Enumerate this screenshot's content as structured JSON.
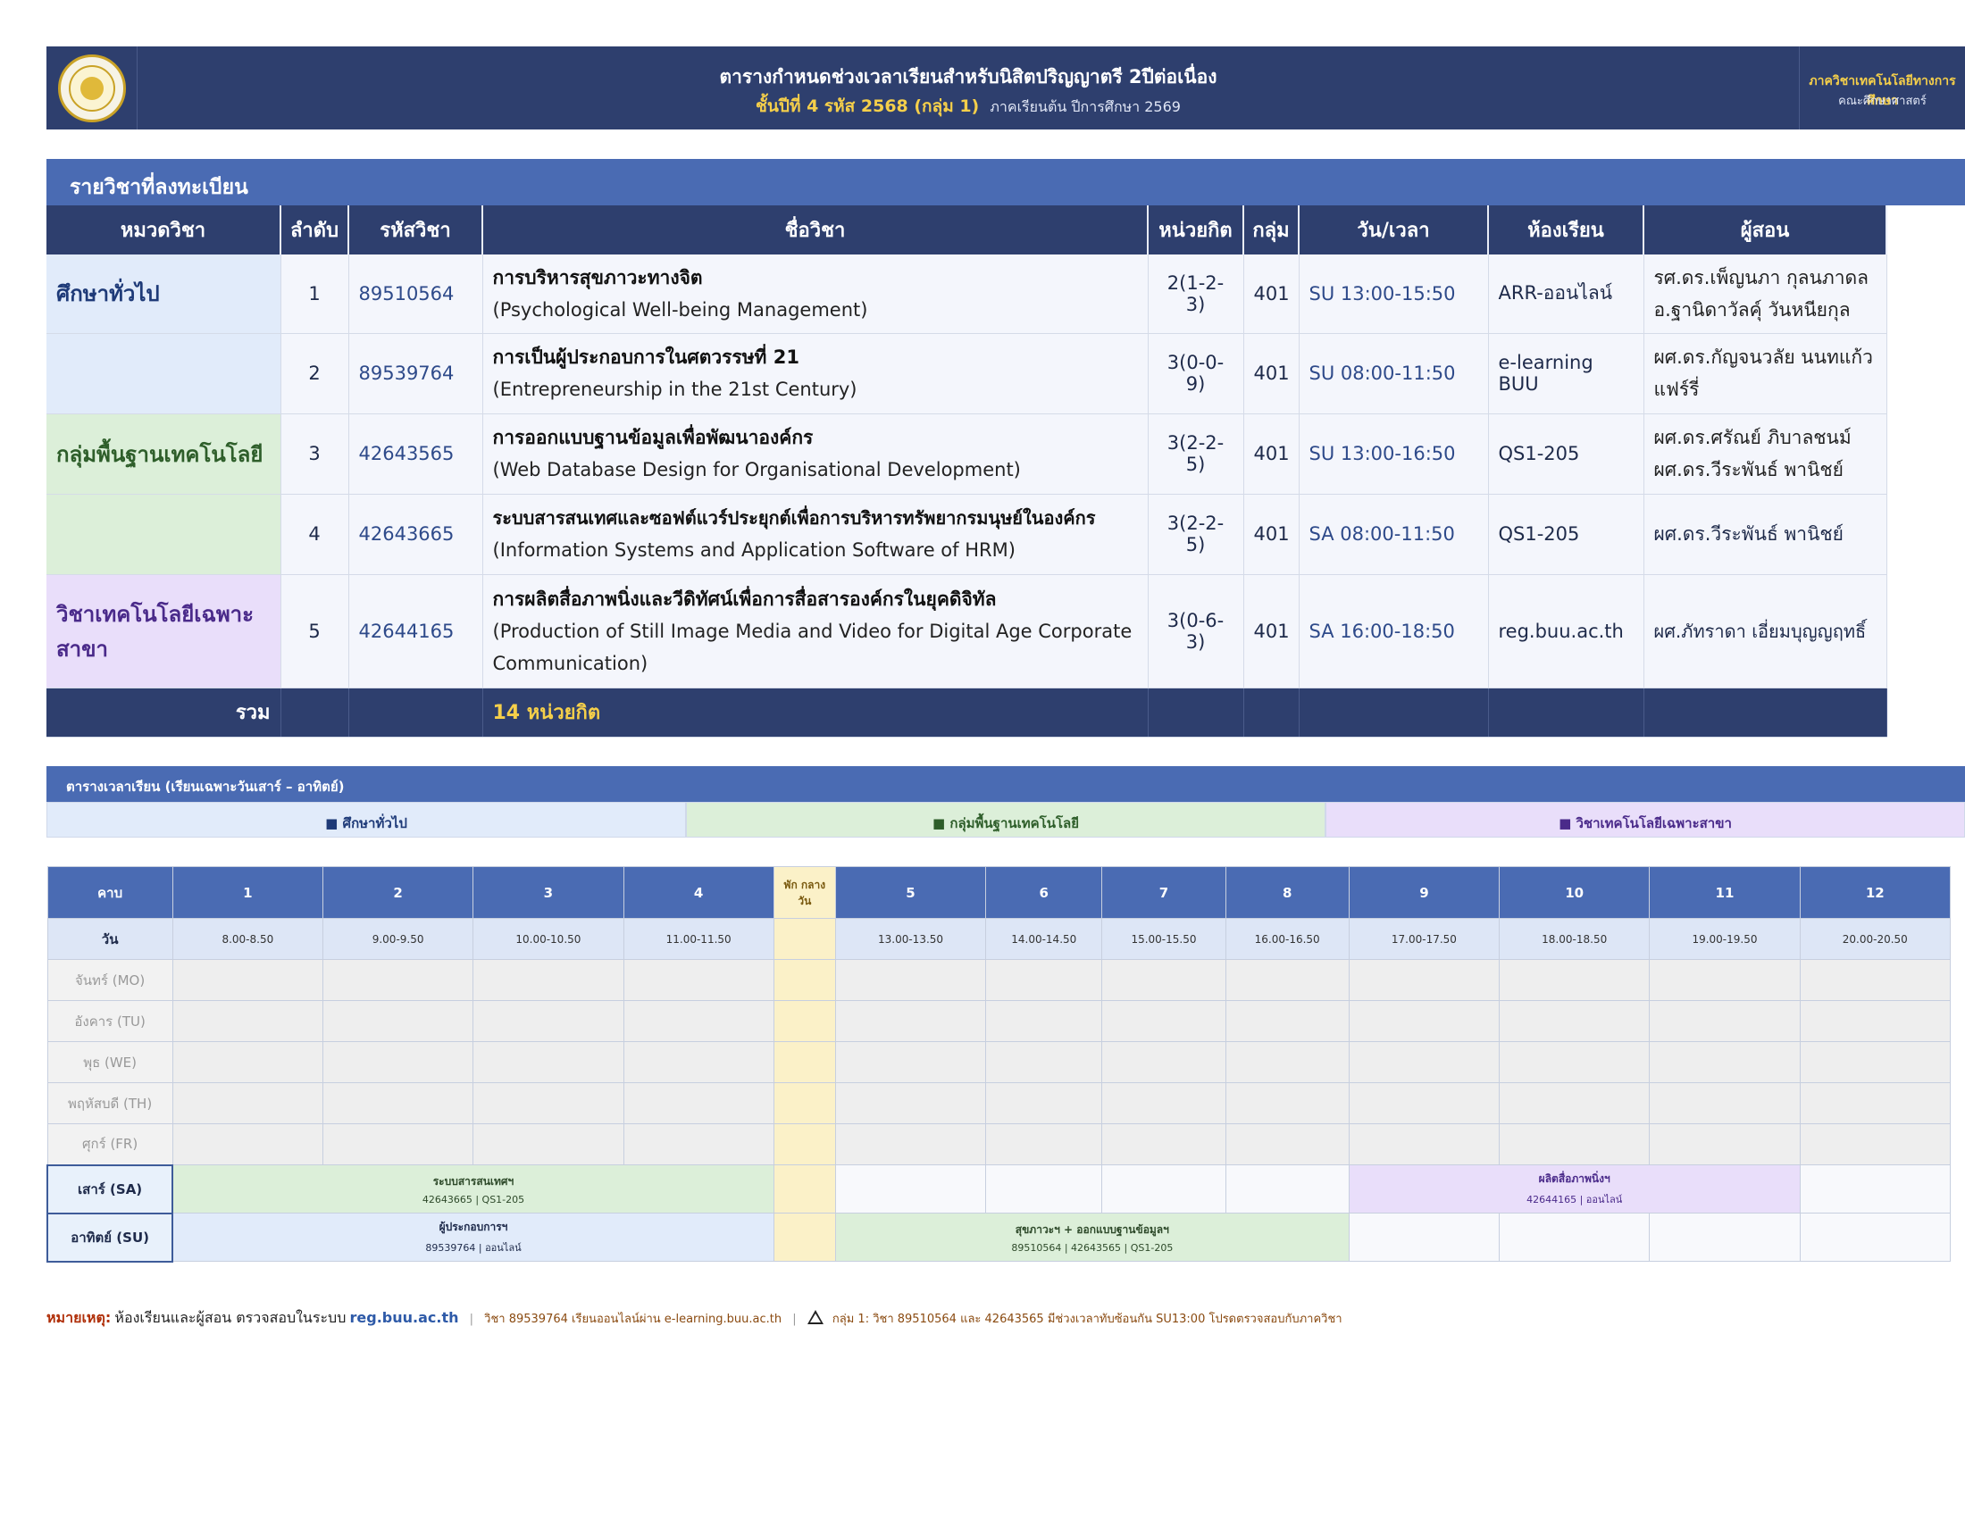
{
  "header": {
    "title": "ตารางกำหนดช่วงเวลาเรียนสำหรับนิสิตปริญญาตรี  2ปีต่อเนื่อง",
    "subtitle_highlight": "ชั้นปีที่ 4  รหัส 2568  (กลุ่ม 1)",
    "subtitle_rest": "ภาคเรียนต้น ปีการศึกษา 2569",
    "dept": "ภาควิชาเทคโนโลยีทางการศึกษา",
    "faculty": "คณะศึกษาศาสตร์"
  },
  "registered": {
    "section_title": "รายวิชาที่ลงทะเบียน",
    "columns": [
      "หมวดวิชา",
      "ลำดับ",
      "รหัสวิชา",
      "ชื่อวิชา",
      "หน่วยกิต",
      "กลุ่ม",
      "วัน/เวลา",
      "ห้องเรียน",
      "ผู้สอน"
    ],
    "categories": [
      "ศึกษาทั่วไป",
      "กลุ่มพื้นฐานเทคโนโลยี",
      "วิชาเทคโนโลยีเฉพาะสาขา"
    ],
    "rows": [
      {
        "no": "1",
        "code": "89510564",
        "name_th": "การบริหารสุขภาวะทางจิต",
        "name_en": "(Psychological Well-being Management)",
        "credit": "2(1-2-3)",
        "group": "401",
        "time": "SU 13:00-15:50",
        "room": "ARR-ออนไลน์",
        "instructor1": "รศ.ดร.เพ็ญนภา กุลนภาดล",
        "instructor2": "อ.ฐานิดาวัลคุ์ วันหนียกุล"
      },
      {
        "no": "2",
        "code": "89539764",
        "name_th": "การเป็นผู้ประกอบการในศตวรรษที่ 21",
        "name_en": "(Entrepreneurship in the 21st Century)",
        "credit": "3(0-0-9)",
        "group": "401",
        "time": "SU 08:00-11:50",
        "room": "e-learning BUU",
        "instructor1": "ผศ.ดร.กัญจนวลัย นนทแก้ว",
        "instructor2": "แฟร์รี่"
      },
      {
        "no": "3",
        "code": "42643565",
        "name_th": "การออกแบบฐานข้อมูลเพื่อพัฒนาองค์กร",
        "name_en": "(Web Database Design for Organisational Development)",
        "credit": "3(2-2-5)",
        "group": "401",
        "time": "SU 13:00-16:50",
        "room": "QS1-205",
        "instructor1": "ผศ.ดร.ศรัณย์ ภิบาลชนม์",
        "instructor2": "ผศ.ดร.วีระพันธ์ พานิชย์"
      },
      {
        "no": "4",
        "code": "42643665",
        "name_th": "ระบบสารสนเทศและซอฟต์แวร์ประยุกต์เพื่อการบริหารทรัพยากรมนุษย์ในองค์กร",
        "name_en": "(Information Systems and Application Software of HRM)",
        "credit": "3(2-2-5)",
        "group": "401",
        "time": "SA 08:00-11:50",
        "room": "QS1-205",
        "instructor1": "ผศ.ดร.วีระพันธ์ พานิชย์",
        "instructor2": ""
      },
      {
        "no": "5",
        "code": "42644165",
        "name_th": "การผลิตสื่อภาพนิ่งและวีดิทัศน์เพื่อการสื่อสารองค์กรในยุคดิจิทัล",
        "name_en": "(Production of Still Image Media and Video for Digital Age Corporate Communication)",
        "credit": "3(0-6-3)",
        "group": "401",
        "time": "SA 16:00-18:50",
        "room": "reg.buu.ac.th",
        "instructor1": "ผศ.ภัทราดา เอี่ยมบุญญฤทธิ์",
        "instructor2": ""
      }
    ],
    "total_label": "รวม",
    "total_value": "14  หน่วยกิต"
  },
  "timetable": {
    "title": "ตารางเวลาเรียน  (เรียนเฉพาะวันเสาร์ – อาทิตย์)",
    "legend": [
      "■  ศึกษาทั่วไป",
      "■  กลุ่มพื้นฐานเทคโนโลยี",
      "■  วิชาเทคโนโลยีเฉพาะสาขา"
    ],
    "period_label": "คาบ",
    "day_label": "วัน",
    "periods": [
      "1",
      "2",
      "3",
      "4",
      "5",
      "6",
      "7",
      "8",
      "9",
      "10",
      "11",
      "12"
    ],
    "break_label_1": "พัก กลาง",
    "break_label_2": "วัน",
    "times": [
      "8.00-8.50",
      "9.00-9.50",
      "10.00-10.50",
      "11.00-11.50",
      "13.00-13.50",
      "14.00-14.50",
      "15.00-15.50",
      "16.00-16.50",
      "17.00-17.50",
      "18.00-18.50",
      "19.00-19.50",
      "20.00-20.50"
    ],
    "days": [
      "จันทร์ (MO)",
      "อังคาร (TU)",
      "พุธ (WE)",
      "พฤหัสบดี (TH)",
      "ศุกร์ (FR)",
      "เสาร์ (SA)",
      "อาทิตย์ (SU)"
    ],
    "blocks": {
      "sa_morning_1": "ระบบสารสนเทศฯ",
      "sa_morning_2": "42643665 | QS1-205",
      "sa_evening_1": "ผลิตสื่อภาพนิ่งฯ",
      "sa_evening_2": "42644165 | ออนไลน์",
      "su_morning_1": "ผู้ประกอบการฯ",
      "su_morning_2": "89539764 | ออนไลน์",
      "su_afternoon_1": "สุขภาวะฯ + ออกแบบฐานข้อมูลฯ",
      "su_afternoon_2": "89510564 | 42643565 | QS1-205"
    }
  },
  "note": {
    "label": "หมายเหตุ:",
    "text1": "ห้องเรียนและผู้สอน ตรวจสอบในระบบ",
    "url": "reg.buu.ac.th",
    "text2": "วิชา 89539764 เรียนออนไลน์ผ่าน e-learning.buu.ac.th",
    "text3": "กลุ่ม 1: วิชา 89510564 และ 42643565 มีช่วงเวลาทับซ้อนกัน SU13:00 โปรดตรวจสอบกับภาควิชา"
  },
  "colors": {
    "navy": "#2e3f6e",
    "blue": "#4a6bb3",
    "gold": "#f5cf4a",
    "general": "#e1ebfa",
    "tech": "#dcefd9",
    "spec": "#e9defa",
    "break": "#fbf1c8"
  }
}
